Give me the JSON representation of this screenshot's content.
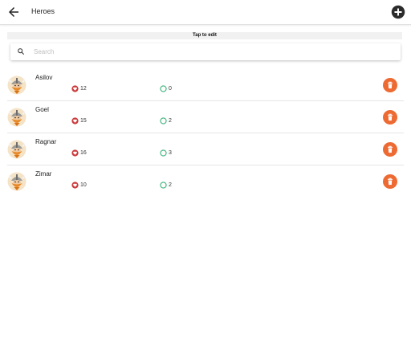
{
  "header": {
    "title": "Heroes"
  },
  "hint": "Tap to edit",
  "search": {
    "placeholder": "Search",
    "value": ""
  },
  "colors": {
    "accent": "#ee6a33",
    "health": "#cc3a3a",
    "kills": "#3bb27a"
  },
  "heroes": [
    {
      "name": "Asilov",
      "health": "12",
      "kills": "0"
    },
    {
      "name": "Goel",
      "health": "15",
      "kills": "2"
    },
    {
      "name": "Ragnar",
      "health": "16",
      "kills": "3"
    },
    {
      "name": "Zimar",
      "health": "10",
      "kills": "2"
    }
  ]
}
